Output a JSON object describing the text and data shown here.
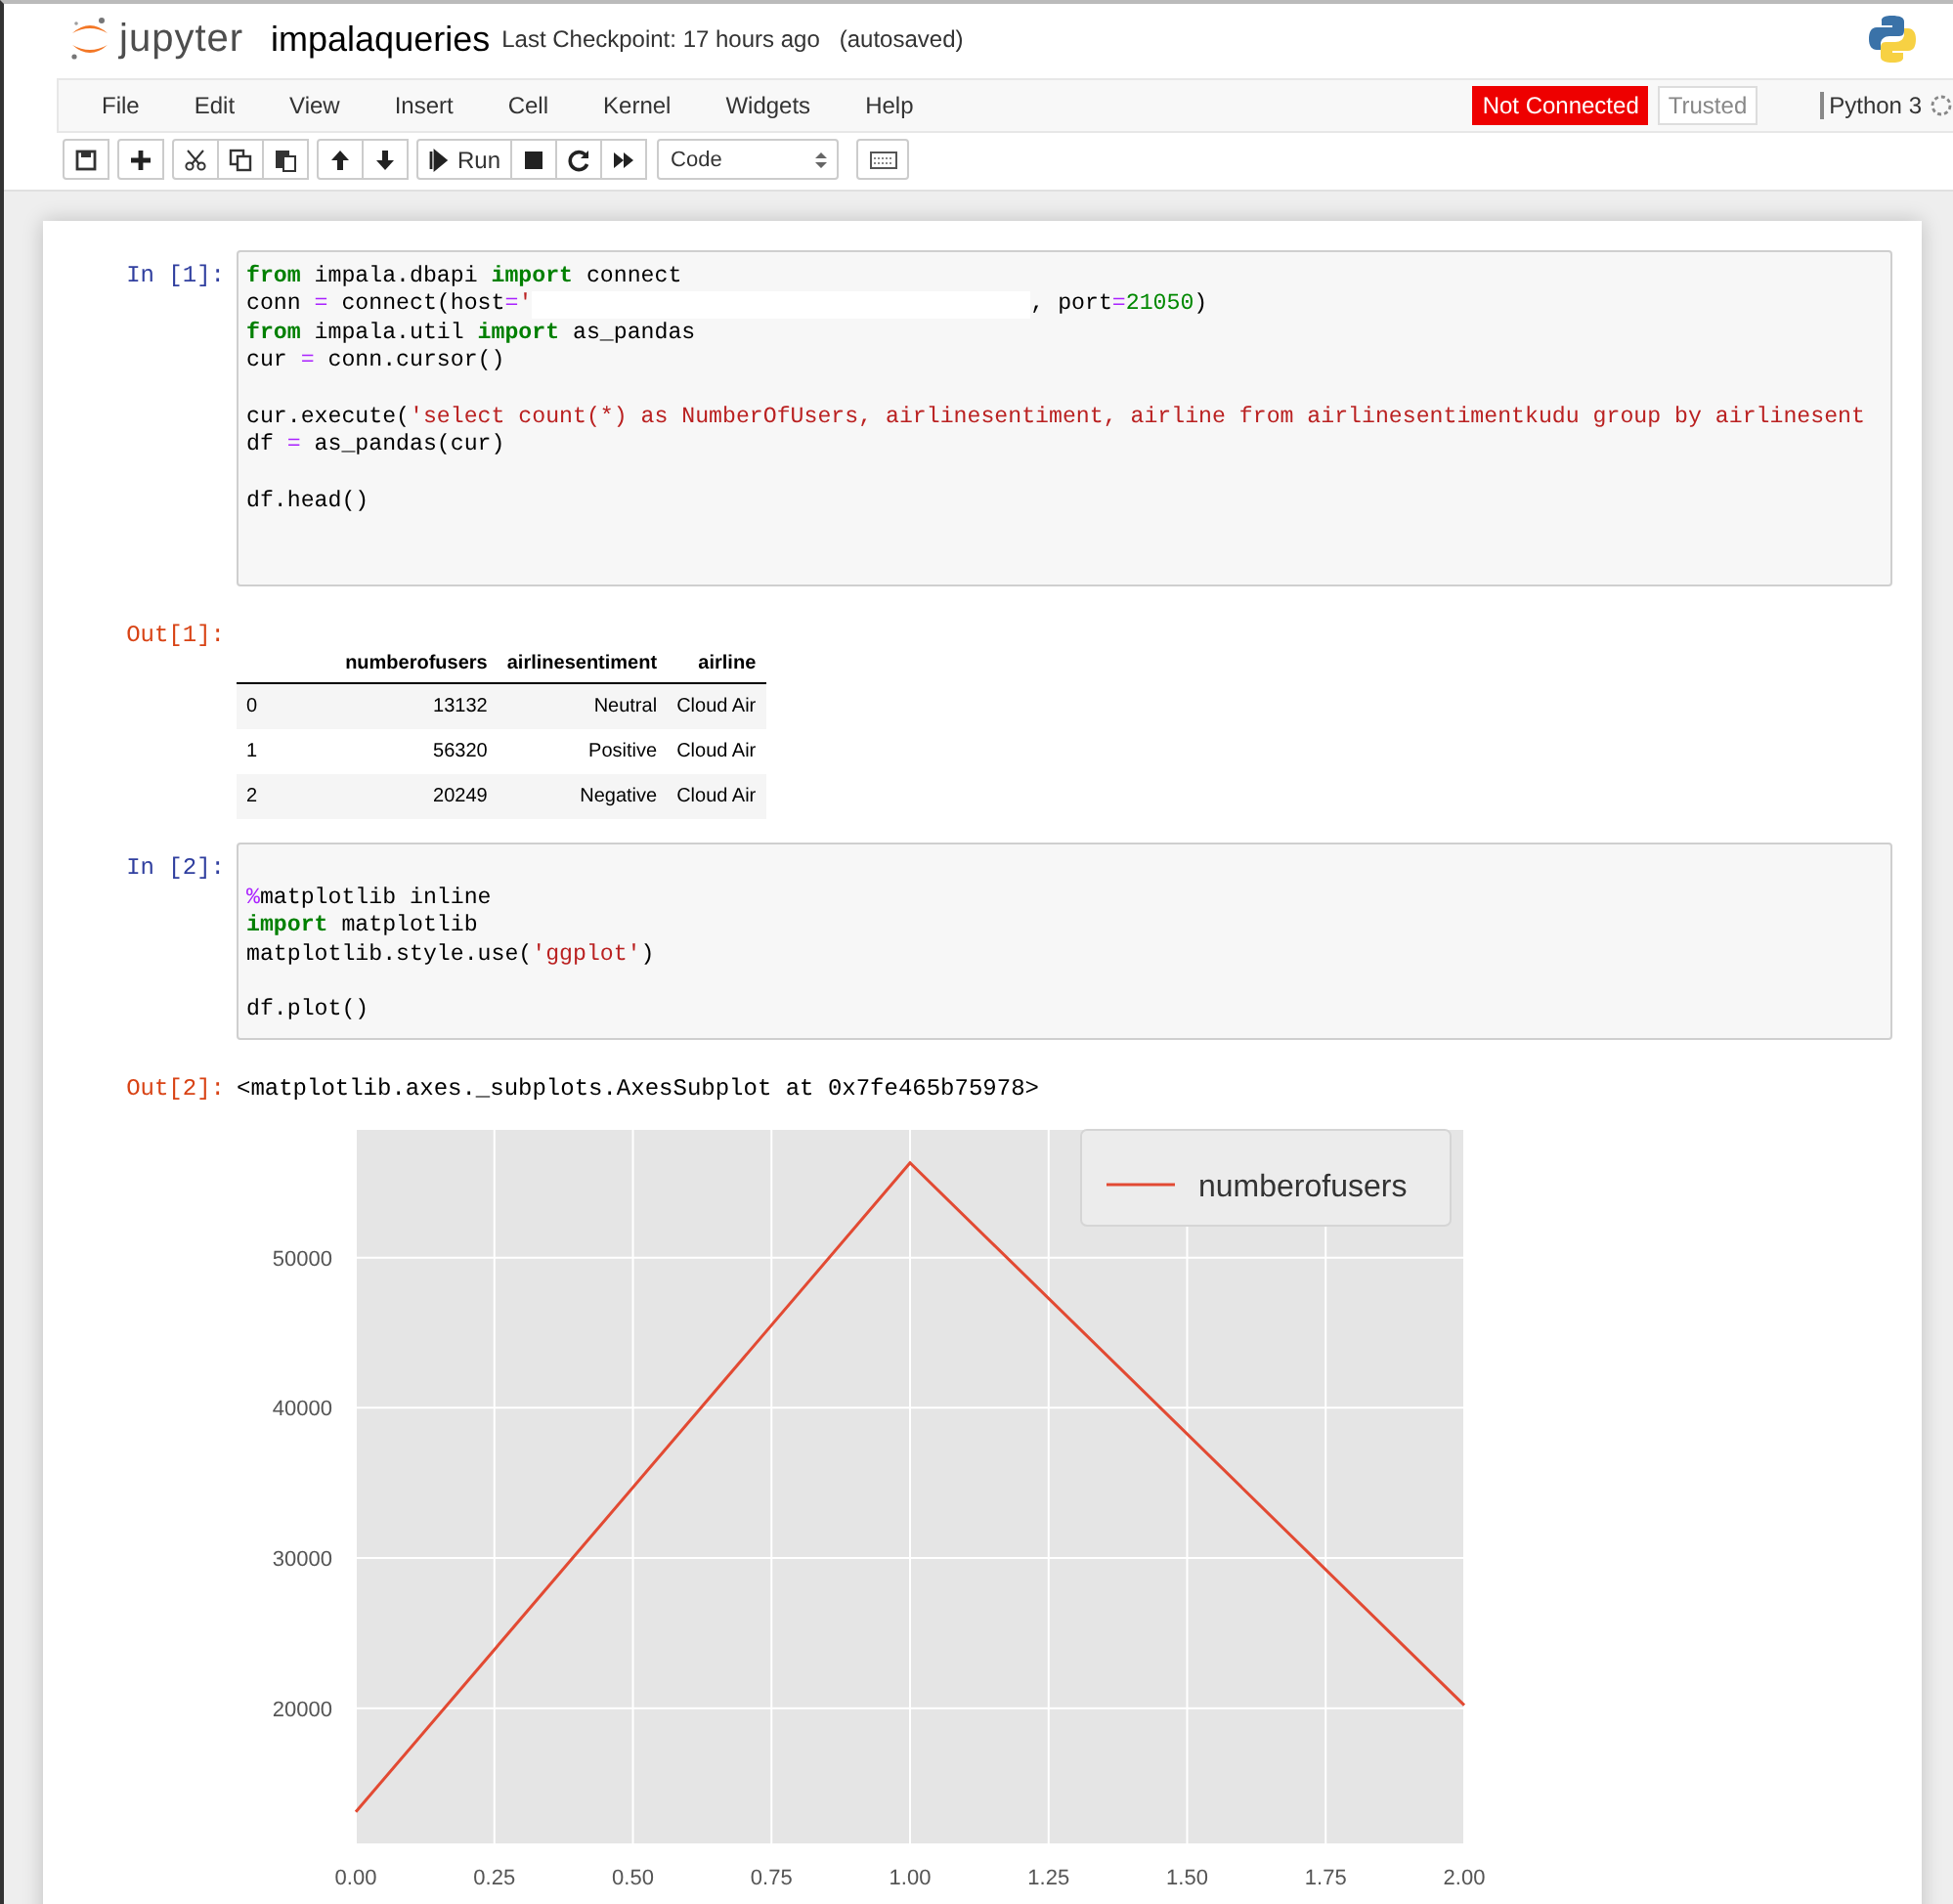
{
  "header": {
    "logo_text": "jupyter",
    "notebook_name": "impalaqueries",
    "checkpoint": "Last Checkpoint: 17 hours ago",
    "autosave": "(autosaved)"
  },
  "menu": [
    "File",
    "Edit",
    "View",
    "Insert",
    "Cell",
    "Kernel",
    "Widgets",
    "Help"
  ],
  "status": {
    "connection": "Not Connected",
    "trust": "Trusted",
    "kernel": "Python 3"
  },
  "toolbar": [
    [
      {
        "kind": "save"
      }
    ],
    [
      {
        "kind": "plus"
      }
    ],
    [
      {
        "kind": "cut"
      },
      {
        "kind": "copy"
      },
      {
        "kind": "paste"
      }
    ],
    [
      {
        "kind": "up"
      },
      {
        "kind": "down"
      }
    ],
    [
      {
        "kind": "run",
        "label": "Run"
      },
      {
        "kind": "stop"
      },
      {
        "kind": "restart"
      },
      {
        "kind": "fastforward"
      }
    ]
  ],
  "cell_type": "Code",
  "cells": [
    {
      "kind": "code",
      "prompt": "In [1]:",
      "lines": [
        {
          "kind": "code",
          "tokens": [
            {
              "kind": "kw",
              "t": "from"
            },
            {
              "kind": "p",
              "t": " impala.dbapi "
            },
            {
              "kind": "kw",
              "t": "import"
            },
            {
              "kind": "p",
              "t": " connect"
            }
          ]
        },
        {
          "kind": "code",
          "tokens": [
            {
              "kind": "p",
              "t": "conn "
            },
            {
              "kind": "op",
              "t": "="
            },
            {
              "kind": "p",
              "t": " connect(host"
            },
            {
              "kind": "op",
              "t": "="
            },
            {
              "kind": "str",
              "t": "'"
            },
            {
              "kind": "redacted"
            },
            {
              "kind": "p",
              "t": ", port"
            },
            {
              "kind": "op",
              "t": "="
            },
            {
              "kind": "num",
              "t": "21050"
            },
            {
              "kind": "p",
              "t": ")"
            }
          ]
        },
        {
          "kind": "code",
          "tokens": [
            {
              "kind": "kw",
              "t": "from"
            },
            {
              "kind": "p",
              "t": " impala.util "
            },
            {
              "kind": "kw",
              "t": "import"
            },
            {
              "kind": "p",
              "t": " as_pandas"
            }
          ]
        },
        {
          "kind": "code",
          "tokens": [
            {
              "kind": "p",
              "t": "cur "
            },
            {
              "kind": "op",
              "t": "="
            },
            {
              "kind": "p",
              "t": " conn.cursor()"
            }
          ]
        },
        {
          "kind": "blank"
        },
        {
          "kind": "code",
          "tokens": [
            {
              "kind": "p",
              "t": "cur.execute("
            },
            {
              "kind": "str",
              "t": "'select count(*) as NumberOfUsers, airlinesentiment, airline from airlinesentimentkudu group by airlinesent"
            }
          ]
        },
        {
          "kind": "code",
          "tokens": [
            {
              "kind": "p",
              "t": "df "
            },
            {
              "kind": "op",
              "t": "="
            },
            {
              "kind": "p",
              "t": " as_pandas(cur)"
            }
          ]
        },
        {
          "kind": "blank"
        },
        {
          "kind": "code",
          "tokens": [
            {
              "kind": "p",
              "t": "df.head()"
            }
          ]
        },
        {
          "kind": "blank"
        },
        {
          "kind": "blank"
        }
      ]
    },
    {
      "kind": "table",
      "prompt": "Out[1]:",
      "columns": [
        "numberofusers",
        "airlinesentiment",
        "airline"
      ],
      "rows": [
        {
          "index": "0",
          "cells": [
            "13132",
            "Neutral",
            "Cloud Air"
          ]
        },
        {
          "index": "1",
          "cells": [
            "56320",
            "Positive",
            "Cloud Air"
          ]
        },
        {
          "index": "2",
          "cells": [
            "20249",
            "Negative",
            "Cloud Air"
          ]
        }
      ]
    },
    {
      "kind": "code",
      "prompt": "In [2]:",
      "lines": [
        {
          "kind": "blank"
        },
        {
          "kind": "code",
          "tokens": [
            {
              "kind": "op",
              "t": "%"
            },
            {
              "kind": "p",
              "t": "matplotlib inline"
            }
          ]
        },
        {
          "kind": "code",
          "tokens": [
            {
              "kind": "kw",
              "t": "import"
            },
            {
              "kind": "p",
              "t": " matplotlib"
            }
          ]
        },
        {
          "kind": "code",
          "tokens": [
            {
              "kind": "p",
              "t": "matplotlib.style.use("
            },
            {
              "kind": "str",
              "t": "'ggplot'"
            },
            {
              "kind": "p",
              "t": ")"
            }
          ]
        },
        {
          "kind": "blank"
        },
        {
          "kind": "code",
          "tokens": [
            {
              "kind": "p",
              "t": "df.plot()"
            }
          ]
        }
      ]
    },
    {
      "kind": "text",
      "prompt": "Out[2]:",
      "text": "<matplotlib.axes._subplots.AxesSubplot at 0x7fe465b75978>"
    },
    {
      "kind": "chart",
      "chart_data": {
        "type": "line",
        "x": [
          0,
          1,
          2
        ],
        "series": [
          {
            "name": "numberofusers",
            "color": "#e24a33",
            "values": [
              13100,
              56300,
              20200
            ]
          }
        ],
        "xlim": [
          0,
          2
        ],
        "ylim": [
          11000,
          58500
        ],
        "xticks": [
          {
            "value": 0,
            "label": "0.00"
          },
          {
            "value": 0.25,
            "label": "0.25"
          },
          {
            "value": 0.5,
            "label": "0.50"
          },
          {
            "value": 0.75,
            "label": "0.75"
          },
          {
            "value": 1,
            "label": "1.00"
          },
          {
            "value": 1.25,
            "label": "1.25"
          },
          {
            "value": 1.5,
            "label": "1.50"
          },
          {
            "value": 1.75,
            "label": "1.75"
          },
          {
            "value": 2,
            "label": "2.00"
          }
        ],
        "yticks": [
          20000,
          30000,
          40000,
          50000
        ],
        "grid": true
      }
    }
  ]
}
